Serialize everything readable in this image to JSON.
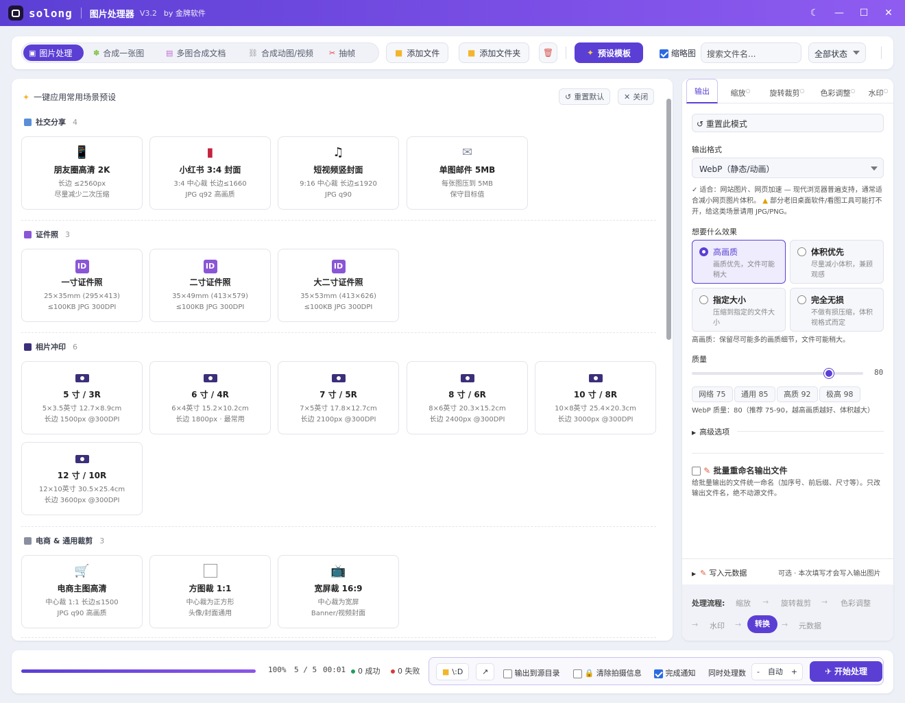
{
  "window": {
    "app_name": "solong",
    "title": "图片处理器",
    "version": "V3.2",
    "by": "by 金牌软件"
  },
  "toolbar": {
    "tabs": [
      {
        "label": "图片处理",
        "icon": "image-icon"
      },
      {
        "label": "合成一张图",
        "icon": "puzzle-icon"
      },
      {
        "label": "多图合成文档",
        "icon": "document-icon"
      },
      {
        "label": "合成动图/视频",
        "icon": "link-icon"
      },
      {
        "label": "抽帧",
        "icon": "scissors-icon"
      }
    ],
    "add_files": "添加文件",
    "add_folder": "添加文件夹",
    "preset_template": "预设模板",
    "thumbnail_label": "缩略图",
    "search_placeholder": "搜索文件名...",
    "status_filter": "全部状态"
  },
  "presets": {
    "header": "一键应用常用场景预设",
    "reset_default": "重置默认",
    "close": "关闭",
    "sections": [
      {
        "title": "社交分享",
        "count": "4",
        "cards": [
          {
            "title": "朋友圈高清 2K",
            "line1": "长边 ≤2560px",
            "line2": "尽量减少二次压缩",
            "icon": "phone-icon"
          },
          {
            "title": "小红书 3:4 封面",
            "line1": "3:4 中心裁 长边≤1660",
            "line2": "JPG q92 高画质",
            "icon": "book-icon"
          },
          {
            "title": "短视频竖封面",
            "line1": "9:16 中心裁 长边≤1920",
            "line2": "JPG q90",
            "icon": "music-icon"
          },
          {
            "title": "单图邮件 5MB",
            "line1": "每张图压到 5MB",
            "line2": "保守目标值",
            "icon": "envelope-icon"
          }
        ]
      },
      {
        "title": "证件照",
        "count": "3",
        "cards": [
          {
            "title": "一寸证件照",
            "line1": "25×35mm (295×413)",
            "line2": "≤100KB JPG 300DPI",
            "icon": "id-icon"
          },
          {
            "title": "二寸证件照",
            "line1": "35×49mm (413×579)",
            "line2": "≤100KB JPG 300DPI",
            "icon": "id-icon"
          },
          {
            "title": "大二寸证件照",
            "line1": "35×53mm (413×626)",
            "line2": "≤100KB JPG 300DPI",
            "icon": "id-icon"
          }
        ]
      },
      {
        "title": "相片冲印",
        "count": "6",
        "cards": [
          {
            "title": "5 寸 / 3R",
            "line1": "5×3.5英寸 12.7×8.9cm",
            "line2": "长边 1500px @300DPI",
            "icon": "camera-icon"
          },
          {
            "title": "6 寸 / 4R",
            "line1": "6×4英寸 15.2×10.2cm",
            "line2": "长边 1800px · 最常用",
            "icon": "camera-icon"
          },
          {
            "title": "7 寸 / 5R",
            "line1": "7×5英寸 17.8×12.7cm",
            "line2": "长边 2100px @300DPI",
            "icon": "camera-icon"
          },
          {
            "title": "8 寸 / 6R",
            "line1": "8×6英寸 20.3×15.2cm",
            "line2": "长边 2400px @300DPI",
            "icon": "camera-icon"
          },
          {
            "title": "10 寸 / 8R",
            "line1": "10×8英寸 25.4×20.3cm",
            "line2": "长边 3000px @300DPI",
            "icon": "camera-icon"
          },
          {
            "title": "12 寸 / 10R",
            "line1": "12×10英寸 30.5×25.4cm",
            "line2": "长边 3600px @300DPI",
            "icon": "camera-icon"
          }
        ]
      },
      {
        "title": "电商 & 通用裁剪",
        "count": "3",
        "cards": [
          {
            "title": "电商主图高清",
            "line1": "中心裁 1:1 长边≤1500",
            "line2": "JPG q90 高画质",
            "icon": "cart-icon"
          },
          {
            "title": "方图裁 1:1",
            "line1": "中心裁为正方形",
            "line2": "头像/封面通用",
            "icon": "square-icon"
          },
          {
            "title": "宽屏裁 16:9",
            "line1": "中心裁为宽屏",
            "line2": "Banner/视频封面",
            "icon": "tv-icon"
          }
        ]
      }
    ]
  },
  "settings": {
    "tabs": [
      "输出",
      "缩放",
      "旋转裁剪",
      "色彩调整",
      "水印"
    ],
    "reset_mode": "重置此模式",
    "format_label": "输出格式",
    "format_value": "WebP（静态/动画）",
    "format_note_1": "✓ 适合：网站图片、网页加速 — 现代浏览器普遍支持，通常适合减小网页图片体积。",
    "format_note_2": "部分老旧桌面软件/看图工具可能打不开，给这类场景请用 JPG/PNG。",
    "effect_label": "想要什么效果",
    "effects": [
      {
        "title": "高画质",
        "desc": "画质优先，文件可能稍大"
      },
      {
        "title": "体积优先",
        "desc": "尽量减小体积，兼顾观感"
      },
      {
        "title": "指定大小",
        "desc": "压缩到指定的文件大小"
      },
      {
        "title": "完全无损",
        "desc": "不做有损压缩，体积视格式而定"
      }
    ],
    "effect_note": "高画质：保留尽可能多的画质细节，文件可能稍大。",
    "quality_label": "质量",
    "quality_value": 80,
    "quality_max": 100,
    "quality_value_text": "80",
    "quality_presets": [
      "网络 75",
      "通用 85",
      "高质 92",
      "极高 98"
    ],
    "quality_note": "WebP 质量：80（推荐 75-90，越高画质越好、体积越大）",
    "advanced": "高级选项",
    "rename_label": "批量重命名输出文件",
    "rename_desc": "给批量输出的文件统一命名（加序号、前后缀、尺寸等）。只改输出文件名，绝不动源文件。",
    "metadata_label": "写入元数据",
    "metadata_hint": "可选 · 本次填写才会写入输出图片",
    "flow_label": "处理流程:",
    "flow": [
      "缩放",
      "旋转裁剪",
      "色彩调整",
      "水印",
      "转换",
      "元数据"
    ]
  },
  "bottom": {
    "progress_fraction": 1.0,
    "percent": "100%",
    "count": "5 / 5",
    "time": "00:01",
    "success": "0 成功",
    "fail": "0 失败",
    "output_dir": "\\:D",
    "output_to_source": "输出到源目录",
    "clear_exif": "清除拍摄信息",
    "notify": "完成通知",
    "concurrency_label": "同时处理数",
    "concurrency_value": "自动",
    "start": "开始处理"
  },
  "colors": {
    "accent": "#5b3fd4",
    "success": "#1e9e5a",
    "fail": "#d63b3b",
    "folder": "#f2b52b"
  }
}
